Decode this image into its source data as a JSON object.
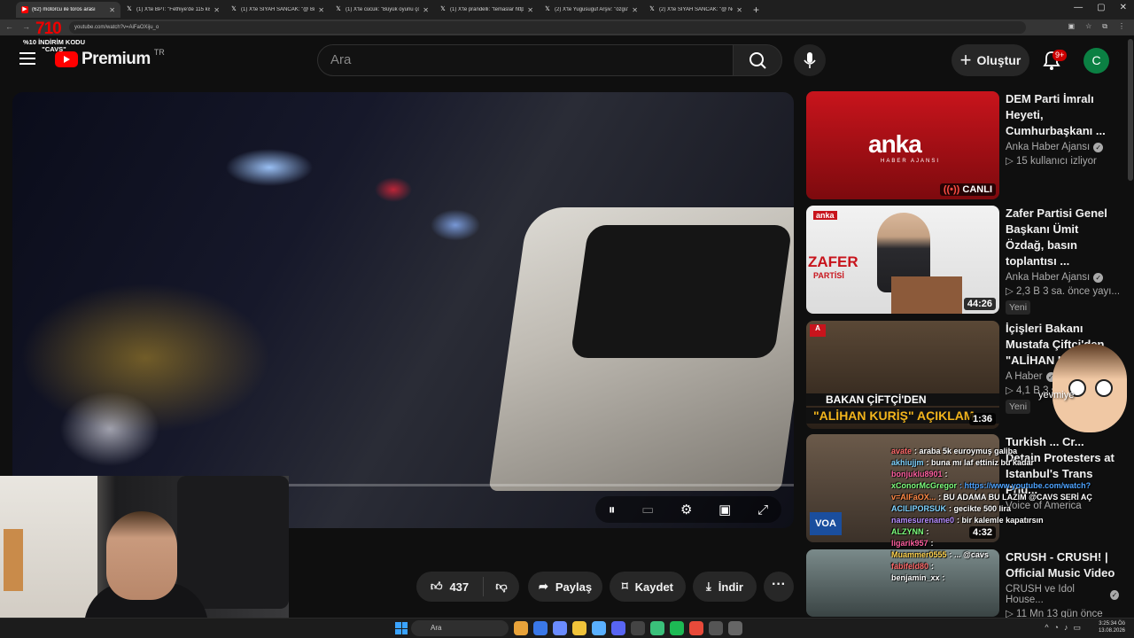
{
  "browser": {
    "tabs": [
      {
        "title": "(62) motorcu ile toros arası",
        "active": true
      },
      {
        "title": "(1) X'te BPT: \"Fethiye'de 115 kiş\"",
        "active": false
      },
      {
        "title": "(1) X'te SİYAH SANCAK: \"@ Bi\"",
        "active": false
      },
      {
        "title": "(1) X'te cücük: \"Büyük oyunu çö\"",
        "active": false
      },
      {
        "title": "(1) X'te prandelli: \"temaslar http\"",
        "active": false
      },
      {
        "title": "(2) X'te Yugusuguf Arşiv: \"özgü\"",
        "active": false
      },
      {
        "title": "(2) X'te SİYAH SANCAK: \"@ Ne\"",
        "active": false
      }
    ],
    "url": "youtube.com/watch?v=AiFaOXiju_o"
  },
  "promo": {
    "big": "7",
    "big_red": "10",
    "line1": "%10 İNDİRİM KODU",
    "line2": "\"CAVS\""
  },
  "header": {
    "logo_text": "Premium",
    "region": "TR",
    "search_placeholder": "Ara",
    "create_label": "Oluştur",
    "notif_count": "9+",
    "avatar_letter": "C"
  },
  "actions": {
    "like_count": "437",
    "share_label": "Paylaş",
    "save_label": "Kaydet",
    "download_label": "İndir"
  },
  "sidebar": [
    {
      "title": "DEM Parti İmralı Heyeti, Cumhurbaşkanı ...",
      "channel": "Anka Haber Ajansı",
      "meta": "▷ 15 kullanıcı izliyor",
      "badge": "",
      "live_label": "CANLI",
      "thumb_logo": "anka",
      "thumb_sub": "HABER AJANSI"
    },
    {
      "title": "Zafer Partisi Genel Başkanı Ümit Özdağ, basın toplantısı ...",
      "channel": "Anka Haber Ajansı",
      "meta": "▷ 2,3 B  3 sa. önce yayı...",
      "badge": "Yeni",
      "duration": "44:26",
      "thumb_text": "ZAFER",
      "thumb_text2": "PARTİSİ",
      "thumb_tag": "anka"
    },
    {
      "title": "İçişleri Bakanı Mustafa Çiftçi'den \"ALİHAN KU...",
      "channel": "A Haber",
      "meta": "▷ 4,1 B  3 s...",
      "badge": "Yeni",
      "duration": "1:36",
      "thumb_line1": "BAKAN ÇİFTÇİ'DEN",
      "thumb_line2": "\"ALİHAN KURİŞ\" AÇIKLAM",
      "thumb_tag": "A"
    },
    {
      "title": "Turkish ... Cr... Detain Protesters at Istanbul's Trans Prid...",
      "channel": "Voice of America",
      "meta": "",
      "badge": "",
      "duration": "4:32",
      "thumb_tag": "VOA"
    },
    {
      "title": "CRUSH - CRUSH! | Official Music Video",
      "channel": "CRUSH ve Idol House...",
      "meta": "▷ 11 Mn  13 gün önce",
      "badge": "",
      "duration": ""
    }
  ],
  "chat": [
    {
      "user": "avate",
      "msg": ": araba 5k euroymuş galiba",
      "color": "#ff6a6a"
    },
    {
      "user": "akhiujjm",
      "msg": ": buna mı laf ettiniz bu kadar",
      "color": "#7fd3ff"
    },
    {
      "user": "bonjuklu8901",
      "msg": ":",
      "color": "#ff5fa0"
    },
    {
      "user": "xConorMcGregor",
      "msg": ": https://www.youtube.com/watch?",
      "color": "#7dff7d"
    },
    {
      "user": "v=AIFaOX...",
      "msg": ": BU ADAMA BU LAZIM @CAVS SERİ AÇ",
      "color": "#ff8844"
    },
    {
      "user": "ACILIPORSUK",
      "msg": ": gecikte 500 lira",
      "color": "#7fd3ff"
    },
    {
      "user": "namesurename0",
      "msg": ": bir kalemle kapatırsın",
      "color": "#b58cff"
    },
    {
      "user": "ALZYNN",
      "msg": ":",
      "color": "#7dff7d"
    },
    {
      "user": "ligarik957",
      "msg": ":",
      "color": "#ff5fa0"
    },
    {
      "user": "Muammer0555",
      "msg": ": ... @cavs",
      "color": "#ffd24d"
    },
    {
      "user": "fabifeld80",
      "msg": ":",
      "color": "#ff6a6a"
    },
    {
      "user": "benjamin_xx",
      "msg": ":",
      "color": "#ffffff"
    }
  ],
  "overlay": {
    "emote_text": "yevmiye"
  },
  "taskbar": {
    "search": "Ara",
    "time": "3:25:34 Öö",
    "date": "13.08.2026"
  }
}
